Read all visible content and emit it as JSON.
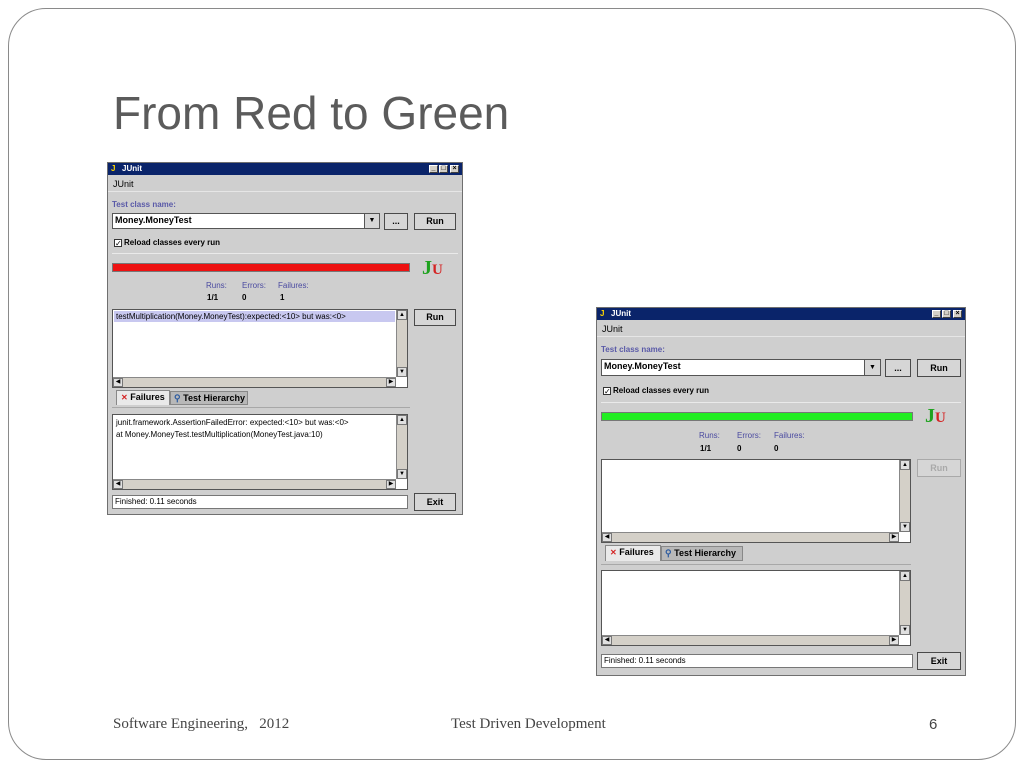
{
  "slide": {
    "title": "From Red to Green",
    "footer_left": "Software Engineering,   2012",
    "footer_center": "Test Driven Development",
    "page_number": "6"
  },
  "colors": {
    "fail_bar": "#ee1111",
    "pass_bar": "#22ee22",
    "title_bar": "#0a246a"
  },
  "windows": [
    {
      "state": "failing",
      "title": "JUnit",
      "menu_label": "JUnit",
      "test_class_label": "Test class name:",
      "test_class_value": "Money.MoneyTest",
      "browse_label": "...",
      "run_label": "Run",
      "reload_label": "Reload classes every run",
      "reload_checked": true,
      "logo_j": "J",
      "logo_u": "U",
      "runs_label": "Runs:",
      "errors_label": "Errors:",
      "failures_label": "Failures:",
      "runs_value": "1/1",
      "errors_value": "0",
      "failures_value": "1",
      "failure_rows": [
        "testMultiplication(Money.MoneyTest):expected:<10> but was:<0>"
      ],
      "run_selected_label": "Run",
      "tab_failures": "Failures",
      "tab_hierarchy": "Test Hierarchy",
      "trace_lines": [
        "junit.framework.AssertionFailedError: expected:<10> but was:<0>",
        "at Money.MoneyTest.testMultiplication(MoneyTest.java:10)"
      ],
      "status_text": "Finished: 0.11 seconds",
      "exit_label": "Exit"
    },
    {
      "state": "passing",
      "title": "JUnit",
      "menu_label": "JUnit",
      "test_class_label": "Test class name:",
      "test_class_value": "Money.MoneyTest",
      "browse_label": "...",
      "run_label": "Run",
      "reload_label": "Reload classes every run",
      "reload_checked": true,
      "logo_j": "J",
      "logo_u": "U",
      "runs_label": "Runs:",
      "errors_label": "Errors:",
      "failures_label": "Failures:",
      "runs_value": "1/1",
      "errors_value": "0",
      "failures_value": "0",
      "failure_rows": [],
      "run_selected_label": "Run",
      "tab_failures": "Failures",
      "tab_hierarchy": "Test Hierarchy",
      "trace_lines": [],
      "status_text": "Finished: 0.11 seconds",
      "exit_label": "Exit"
    }
  ]
}
